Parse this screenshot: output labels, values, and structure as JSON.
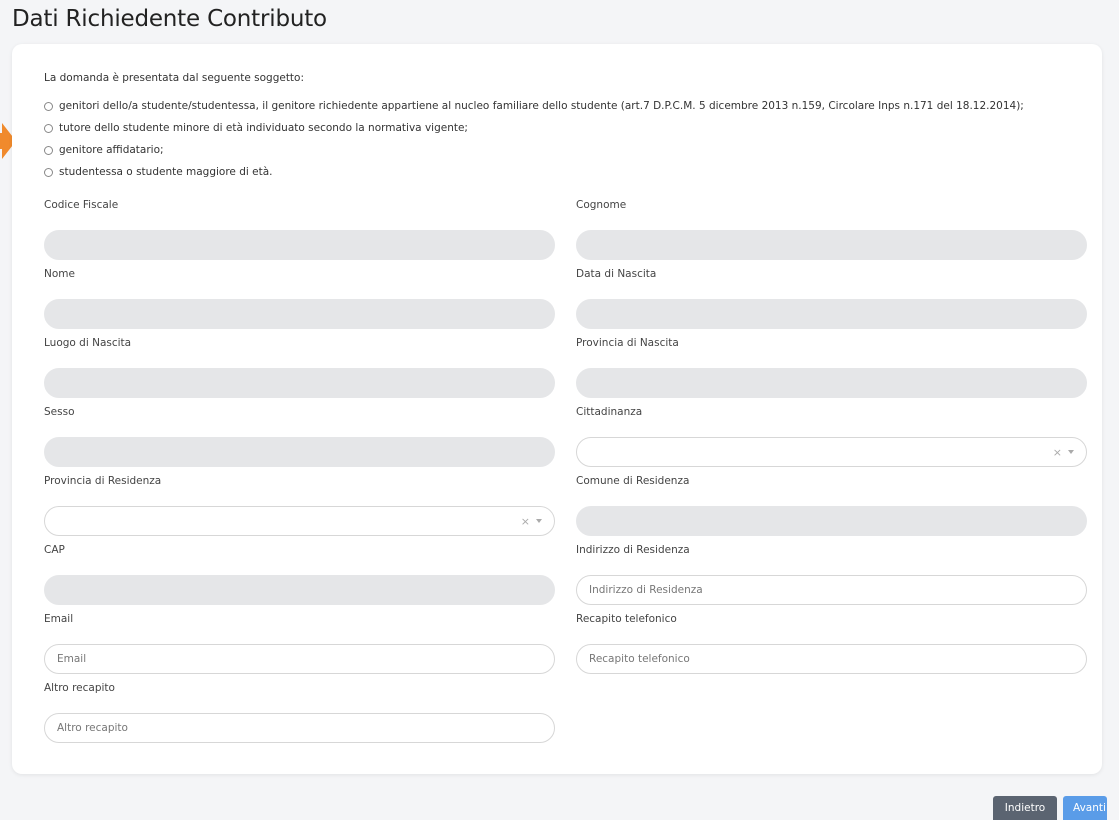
{
  "page_title": "Dati Richiedente Contributo",
  "intro": "La domanda è presentata dal seguente soggetto:",
  "options": [
    "genitori dello/a studente/studentessa, il genitore richiedente appartiene al nucleo familiare dello studente (art.7 D.P.C.M. 5 dicembre 2013 n.159, Circolare Inps n.171 del 18.12.2014);",
    "tutore dello studente minore di età individuato secondo la normativa vigente;",
    "genitore affidatario;",
    "studentessa o studente maggiore di età."
  ],
  "fields": {
    "codice_fiscale": {
      "label": "Codice Fiscale"
    },
    "cognome": {
      "label": "Cognome"
    },
    "nome": {
      "label": "Nome"
    },
    "data_nascita": {
      "label": "Data di Nascita"
    },
    "luogo_nascita": {
      "label": "Luogo di Nascita"
    },
    "provincia_nascita": {
      "label": "Provincia di Nascita"
    },
    "sesso": {
      "label": "Sesso"
    },
    "cittadinanza": {
      "label": "Cittadinanza"
    },
    "provincia_residenza": {
      "label": "Provincia di Residenza"
    },
    "comune_residenza": {
      "label": "Comune di Residenza"
    },
    "cap": {
      "label": "CAP"
    },
    "indirizzo_residenza": {
      "label": "Indirizzo di Residenza",
      "placeholder": "Indirizzo di Residenza"
    },
    "email": {
      "label": "Email",
      "placeholder": "Email"
    },
    "recapito_telefonico": {
      "label": "Recapito telefonico",
      "placeholder": "Recapito telefonico"
    },
    "altro_recapito": {
      "label": "Altro recapito",
      "placeholder": "Altro recapito"
    }
  },
  "select_clear_glyph": "×",
  "buttons": {
    "back": "Indietro",
    "next": "Avanti"
  },
  "colors": {
    "accent_arrow": "#f08a2c",
    "button_back": "#5b6471",
    "button_next": "#5a9ce8",
    "disabled_field": "#e5e6e8"
  }
}
